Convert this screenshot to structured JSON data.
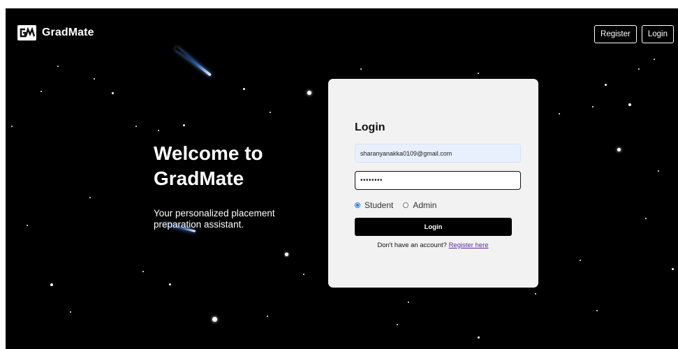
{
  "navbar": {
    "logo_text": "GM",
    "brand_name": "GradMate",
    "register_label": "Register",
    "login_label": "Login"
  },
  "hero": {
    "title": "Welcome to GradMate",
    "subtitle": "Your personalized placement preparation assistant."
  },
  "login_form": {
    "title": "Login",
    "email_value": "sharanyanakka0109@gmail.com",
    "password_value": "••••••••",
    "roles": [
      {
        "label": "Student",
        "selected": true
      },
      {
        "label": "Admin",
        "selected": false
      }
    ],
    "submit_label": "Login",
    "register_prompt": "Don't have an account?",
    "register_link": "Register here"
  },
  "colors": {
    "background": "#000000",
    "card": "#f2f2f2",
    "autofill": "#e8f0fe",
    "radio_accent": "#1a73e8",
    "link": "#5a2ca0"
  }
}
